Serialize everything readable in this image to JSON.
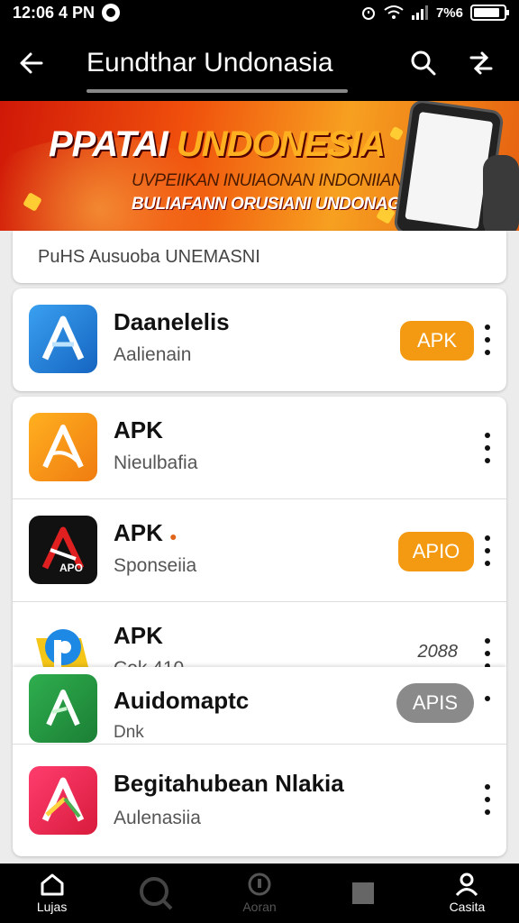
{
  "status_bar": {
    "time": "12:06 4 PN",
    "battery_text": "7%6"
  },
  "app_bar": {
    "title": "Eundthar Undonasia"
  },
  "banner": {
    "headline_a": "PPATAI",
    "headline_b": "UNDONESIA",
    "line1": "UVPEIIKAN INUIAONAN INDONIIAN",
    "line2": "BULIAFANN ORUSIANI UNDONAGAN"
  },
  "search": {
    "text": "PuHS Ausuoba UNEMASNI"
  },
  "apps": [
    {
      "name": "Daanelelis",
      "subtitle": "Aalienain",
      "button": "APK"
    },
    {
      "name": "APK",
      "subtitle": "Nieulbafia"
    },
    {
      "name": "APK",
      "subtitle": "Sponseiia",
      "button": "APIO",
      "icon_caption": "APO"
    },
    {
      "name": "APK",
      "subtitle": "Cok    410",
      "size": "2088"
    },
    {
      "name": "Auidomaptc",
      "subtitle": "Dnk",
      "button": "APIS"
    },
    {
      "name": "Begitahubean Nlakia",
      "subtitle": "Aulenasiia"
    }
  ],
  "bottom_nav": [
    {
      "label": "Lujas",
      "icon": "home-icon"
    },
    {
      "label": "",
      "icon": "search-icon"
    },
    {
      "label": "Aoran",
      "icon": "download-icon"
    },
    {
      "label": "",
      "icon": "square-icon"
    },
    {
      "label": "Casita",
      "icon": "account-icon"
    }
  ],
  "colors": {
    "accent_orange": "#f39a12",
    "bar_black": "#000000",
    "pill_gray": "#8a8a8a"
  }
}
